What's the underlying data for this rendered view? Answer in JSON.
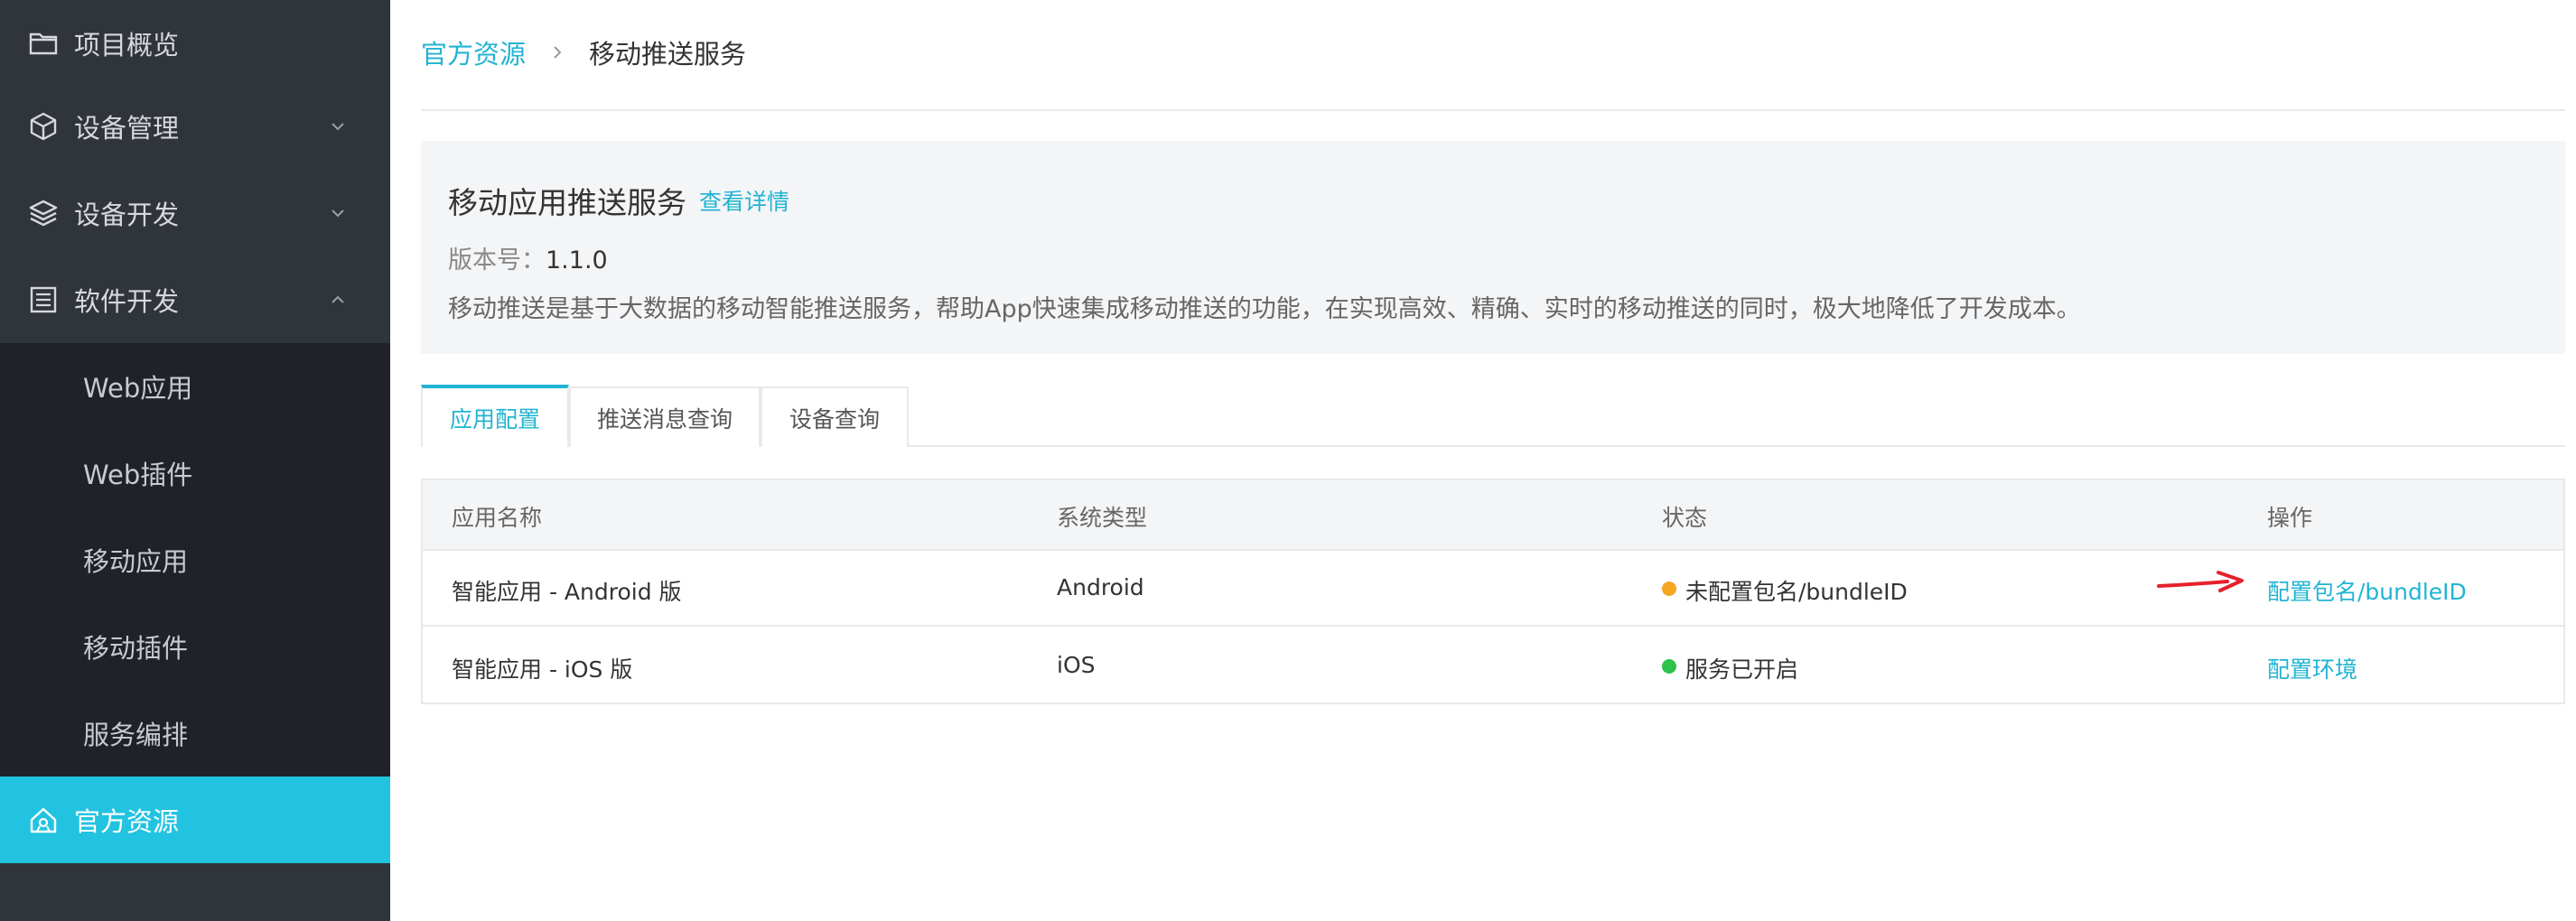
{
  "sidebar": {
    "items": [
      {
        "label": "项目概览",
        "icon": "folder-icon"
      },
      {
        "label": "设备管理",
        "icon": "cube-icon"
      },
      {
        "label": "设备开发",
        "icon": "layers-icon"
      },
      {
        "label": "软件开发",
        "icon": "document-icon"
      }
    ],
    "submenu": [
      {
        "label": "Web应用"
      },
      {
        "label": "Web插件"
      },
      {
        "label": "移动应用"
      },
      {
        "label": "移动插件"
      },
      {
        "label": "服务编排"
      }
    ],
    "active": {
      "label": "官方资源",
      "icon": "home-icon"
    }
  },
  "breadcrumb": {
    "link": "官方资源",
    "current": "移动推送服务"
  },
  "info": {
    "title": "移动应用推送服务",
    "detail_link": "查看详情",
    "version_label": "版本号：",
    "version_value": "1.1.0",
    "description": "移动推送是基于大数据的移动智能推送服务，帮助App快速集成移动推送的功能，在实现高效、精确、实时的移动推送的同时，极大地降低了开发成本。"
  },
  "tabs": [
    {
      "label": "应用配置",
      "active": true
    },
    {
      "label": "推送消息查询",
      "active": false
    },
    {
      "label": "设备查询",
      "active": false
    }
  ],
  "table": {
    "headers": [
      "应用名称",
      "系统类型",
      "状态",
      "操作"
    ],
    "rows": [
      {
        "name": "智能应用 - Android 版",
        "system": "Android",
        "status": "未配置包名/bundleID",
        "status_color": "#f5a623",
        "action": "配置包名/bundleID"
      },
      {
        "name": "智能应用 - iOS 版",
        "system": "iOS",
        "status": "服务已开启",
        "status_color": "#2dc34a",
        "action": "配置环境"
      }
    ]
  },
  "colors": {
    "accent": "#21b4d2",
    "sidebar_bg": "#30343b",
    "submenu_bg": "#1f2329",
    "active_bg": "#22c3e0",
    "annotation_arrow": "#e5212b"
  }
}
